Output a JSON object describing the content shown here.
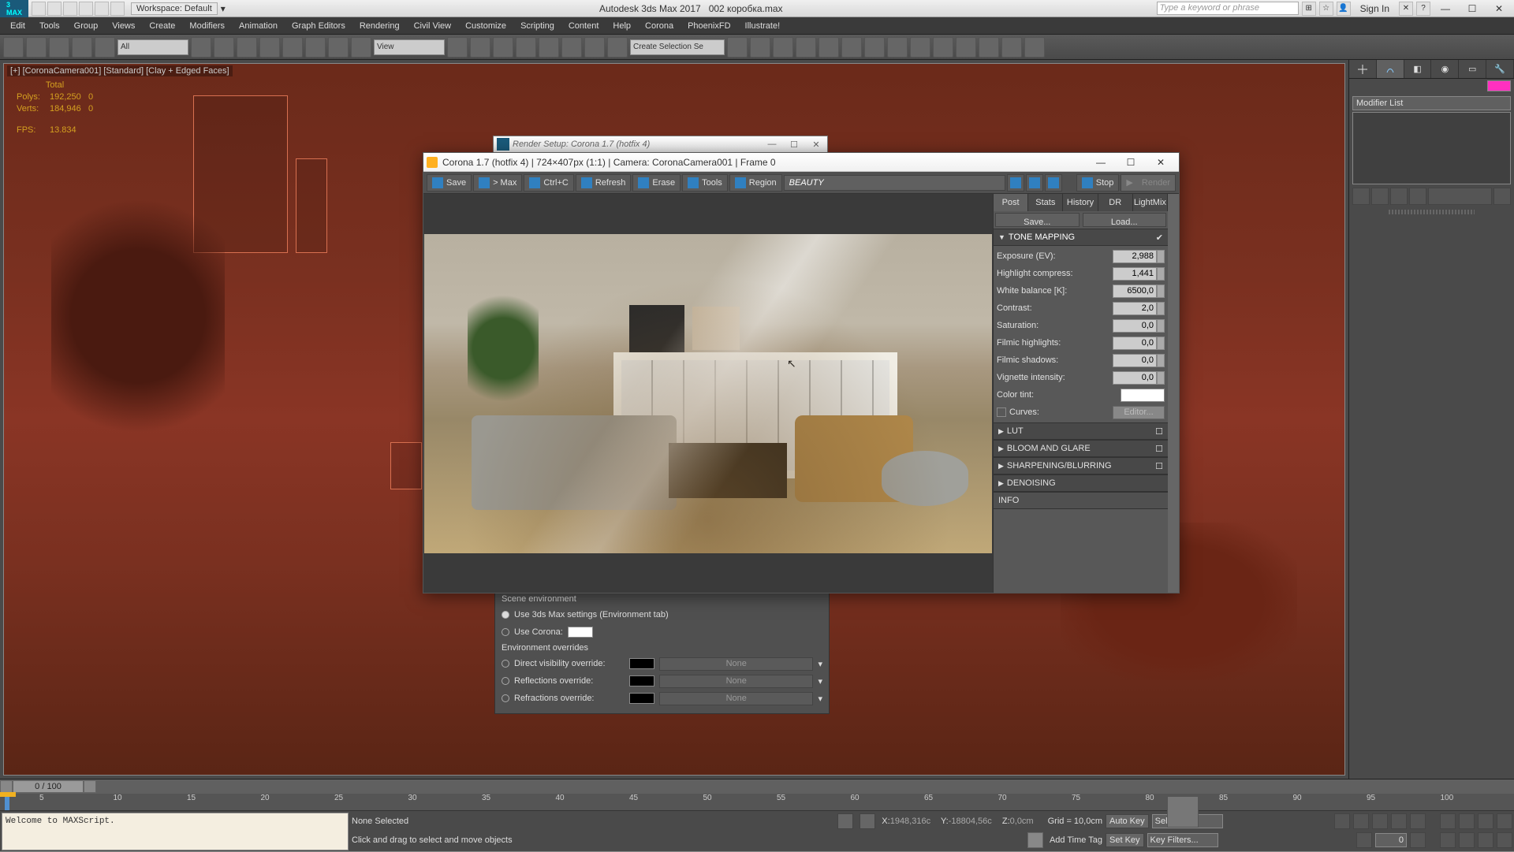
{
  "app": {
    "title_left": "Autodesk 3ds Max 2017",
    "title_file": "002 коробка.max",
    "workspace_label": "Workspace: Default",
    "search_placeholder": "Type a keyword or phrase",
    "sign_in": "Sign In"
  },
  "main_menu": [
    "Edit",
    "Tools",
    "Group",
    "Views",
    "Create",
    "Modifiers",
    "Animation",
    "Graph Editors",
    "Rendering",
    "Civil View",
    "Customize",
    "Scripting",
    "Content",
    "Help",
    "Corona",
    "PhoenixFD",
    "Illustrate!"
  ],
  "main_toolbar": {
    "filter_all": "All",
    "view_label": "View",
    "selection_set": "Create Selection Se"
  },
  "viewport": {
    "label": "[+] [CoronaCamera001] [Standard] [Clay + Edged Faces]",
    "stats": {
      "total_label": "Total",
      "polys_label": "Polys:",
      "polys": "192,250",
      "polys_sel": "0",
      "verts_label": "Verts:",
      "verts": "184,946",
      "verts_sel": "0",
      "fps_label": "FPS:",
      "fps": "13.834"
    }
  },
  "render_setup": {
    "title": "Render Setup: Corona 1.7 (hotfix 4)"
  },
  "env_panel": {
    "header": "Scene environment",
    "opt1": "Use 3ds Max settings (Environment tab)",
    "opt2": "Use Corona:",
    "overrides_header": "Environment overrides",
    "r1": "Direct visibility override:",
    "r2": "Reflections override:",
    "r3": "Refractions override:",
    "none": "None"
  },
  "vfb": {
    "title": "Corona 1.7 (hotfix 4) | 724×407px (1:1) | Camera: CoronaCamera001 | Frame 0",
    "toolbar": {
      "save": "Save",
      "tomax": "> Max",
      "copy": "Ctrl+C",
      "refresh": "Refresh",
      "erase": "Erase",
      "tools": "Tools",
      "region": "Region",
      "stop": "Stop",
      "render": "Render",
      "pass": "BEAUTY"
    },
    "tabs": [
      "Post",
      "Stats",
      "History",
      "DR",
      "LightMix"
    ],
    "tab_active": "Post",
    "save_btn": "Save...",
    "load_btn": "Load...",
    "sections": {
      "tone": "TONE MAPPING",
      "lut": "LUT",
      "bloom": "BLOOM AND GLARE",
      "sharpen": "SHARPENING/BLURRING",
      "denoise": "DENOISING",
      "info": "INFO"
    },
    "params": {
      "exposure_l": "Exposure (EV):",
      "exposure_v": "2,988",
      "highlight_l": "Highlight compress:",
      "highlight_v": "1,441",
      "wb_l": "White balance [K]:",
      "wb_v": "6500,0",
      "contrast_l": "Contrast:",
      "contrast_v": "2,0",
      "saturation_l": "Saturation:",
      "saturation_v": "0,0",
      "fhl_l": "Filmic highlights:",
      "fhl_v": "0,0",
      "fsh_l": "Filmic shadows:",
      "fsh_v": "0,0",
      "vig_l": "Vignette intensity:",
      "vig_v": "0,0",
      "tint_l": "Color tint:",
      "curves_l": "Curves:",
      "curves_btn": "Editor..."
    }
  },
  "cmd_panel": {
    "modifier_list": "Modifier List"
  },
  "timeline": {
    "slider_label": "0 / 100",
    "ticks": [
      "5",
      "10",
      "15",
      "20",
      "25",
      "30",
      "35",
      "40",
      "45",
      "50",
      "55",
      "60",
      "65",
      "70",
      "75",
      "80",
      "85",
      "90",
      "95",
      "100"
    ]
  },
  "status": {
    "script": "Welcome to MAXScript.",
    "selection": "None Selected",
    "prompt": "Click and drag to select and move objects",
    "x_l": "X:",
    "x_v": "1948,316c",
    "y_l": "Y:",
    "y_v": "-18804,56c",
    "z_l": "Z:",
    "z_v": "0,0cm",
    "grid": "Grid = 10,0cm",
    "add_time_tag": "Add Time Tag",
    "auto_key": "Auto Key",
    "set_key": "Set Key",
    "selected": "Selected",
    "key_filters": "Key Filters..."
  }
}
